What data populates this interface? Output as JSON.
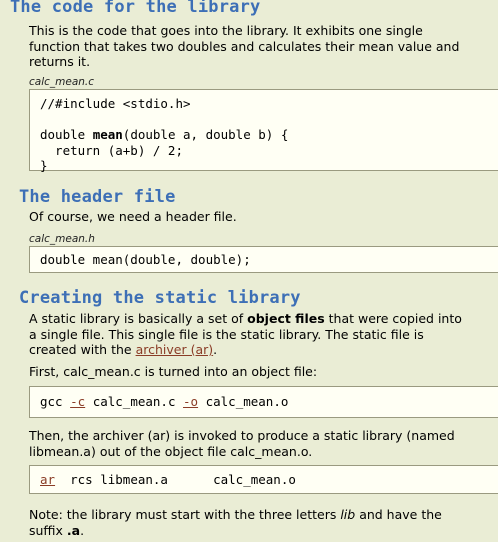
{
  "section1": {
    "heading": "The code for the library",
    "text": "This is the code that goes into the library. It exhibits one single function that takes two doubles and calculates their mean value and returns it.",
    "caption": "calc_mean.c",
    "code": {
      "line1": "//#include <stdio.h>",
      "line2_pre": "double ",
      "line2_fn": "mean",
      "line2_post": "(double a, double b) {",
      "line3": "  return (a+b) / 2;",
      "line4": "}"
    }
  },
  "section2": {
    "heading": "The header file",
    "text": "Of course, we need a header file.",
    "caption": "calc_mean.h",
    "code": "double mean(double, double);"
  },
  "section3": {
    "heading": "Creating the static library",
    "p1": {
      "before": "A static library is basically a set of ",
      "bold": "object files",
      "middle": " that were copied into a single file. This single file is the static library. The static file is created with the ",
      "link": "archiver (ar)",
      "after": "."
    },
    "p2": "First, calc_mean.c is turned into an object file:",
    "cmd1": {
      "gcc": "gcc ",
      "c_flag": "-c",
      "mid": " calc_mean.c ",
      "o_flag": "-o",
      "end": " calc_mean.o"
    },
    "p3": "Then, the archiver (ar) is invoked to produce a static library (named libmean.a) out of the object file calc_mean.o.",
    "cmd2": {
      "ar": "ar",
      "rest": "  rcs libmean.a      calc_mean.o"
    },
    "note": {
      "before": "Note: the library must start with the three letters ",
      "lib": "lib",
      "middle": " and have the suffix ",
      "suffix": ".a",
      "after": "."
    }
  }
}
